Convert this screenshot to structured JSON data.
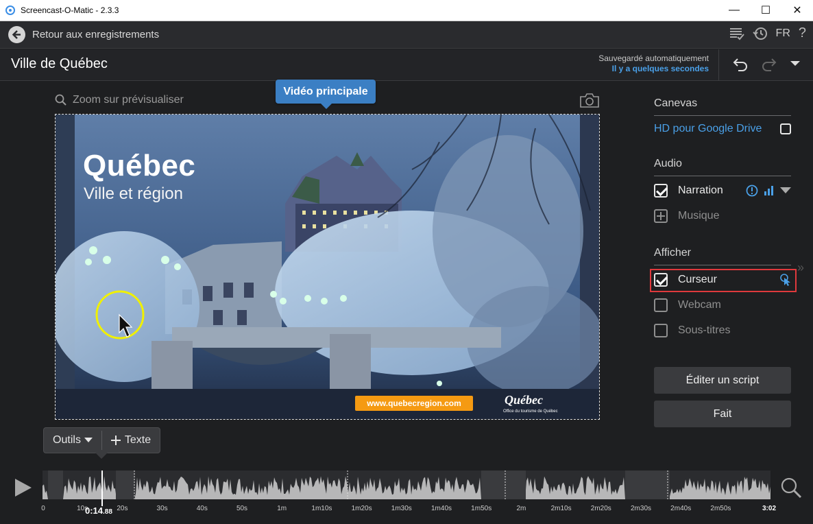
{
  "window": {
    "title": "Screencast-O-Matic - 2.3.3",
    "minimize_glyph": "—",
    "maximize_glyph": "☐",
    "close_glyph": "✕"
  },
  "nav": {
    "back_label": "Retour aux enregistrements",
    "language": "FR",
    "help": "?"
  },
  "project": {
    "title": "Ville de Québec",
    "autosave_line1": "Sauvegardé automatiquement",
    "autosave_line2": "Il y a quelques secondes"
  },
  "preview": {
    "zoom_label": "Zoom sur prévisualiser",
    "main_video_tooltip": "Vidéo principale",
    "overlay_title": "Québec",
    "overlay_subtitle": "Ville et région",
    "url_badge": "www.quebecregion.com",
    "logo_text": "Québec",
    "logo_subtext": "Office du tourisme de Québec"
  },
  "tools": {
    "outils_label": "Outils",
    "texte_label": "Texte"
  },
  "panel": {
    "canvas_header": "Canevas",
    "canvas_option": "HD pour Google Drive",
    "audio_header": "Audio",
    "narration_label": "Narration",
    "musique_label": "Musique",
    "afficher_header": "Afficher",
    "curseur_label": "Curseur",
    "webcam_label": "Webcam",
    "soustitres_label": "Sous-titres",
    "script_button": "Éditer un script",
    "done_button": "Fait"
  },
  "timeline": {
    "playhead_main": "0:14",
    "playhead_frac": ".88",
    "ticks": [
      "0",
      "10s",
      "20s",
      "30s",
      "40s",
      "50s",
      "1m",
      "1m10s",
      "1m20s",
      "1m30s",
      "1m40s",
      "1m50s",
      "2m",
      "2m10s",
      "2m20s",
      "2m30s",
      "2m40s",
      "2m50s",
      "3:02"
    ]
  },
  "colors": {
    "accent_blue": "#3b7fc4",
    "link_blue": "#4aa0e8",
    "highlight_red": "#e0393c",
    "url_orange": "#f59a12"
  }
}
